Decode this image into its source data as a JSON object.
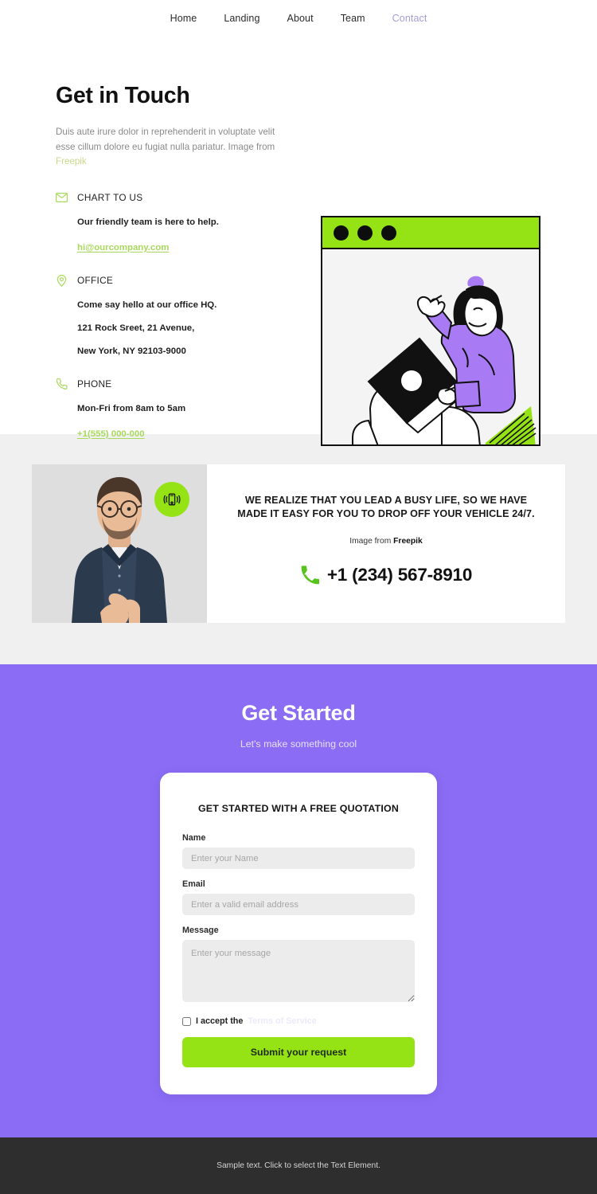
{
  "nav": {
    "items": [
      {
        "label": "Home",
        "active": false
      },
      {
        "label": "Landing",
        "active": false
      },
      {
        "label": "About",
        "active": false
      },
      {
        "label": "Team",
        "active": false
      },
      {
        "label": "Contact",
        "active": true
      }
    ]
  },
  "hero": {
    "title": "Get in Touch",
    "description": "Duis aute irure dolor in reprehenderit in voluptate velit esse cillum dolore eu fugiat nulla pariatur. Image from",
    "credit": "Freepik",
    "contacts": [
      {
        "icon": "envelope-icon",
        "title": "CHART TO US",
        "line1": "Our friendly team is here to help.",
        "link": "hi@ourcompany.com"
      },
      {
        "icon": "map-pin-icon",
        "title": "OFFICE",
        "line1": "Come say hello at our office HQ.",
        "line2": "121 Rock Sreet, 21 Avenue,",
        "line3": "New York, NY 92103-9000"
      },
      {
        "icon": "phone-icon",
        "title": "PHONE",
        "line1": "Mon-Fri from 8am to 5am",
        "link": "+1(555) 000-000"
      }
    ],
    "illustration": {
      "name": "browser-window-illustration",
      "dots": 3,
      "bar_color": "#95e215"
    }
  },
  "banner": {
    "photo_alt": "man-with-glasses-photo",
    "badge_icon": "vibrating-phone-icon",
    "headline": "WE REALIZE THAT YOU LEAD A BUSY LIFE, SO WE HAVE MADE IT EASY FOR YOU TO DROP OFF YOUR VEHICLE 24/7.",
    "credit_prefix": "Image from ",
    "credit_source": "Freepik",
    "phone": "+1 (234) 567-8910"
  },
  "cta": {
    "title": "Get Started",
    "subtitle": "Let's make something cool",
    "form": {
      "title": "GET STARTED WITH A FREE QUOTATION",
      "name_label": "Name",
      "name_placeholder": "Enter your Name",
      "name_value": "",
      "email_label": "Email",
      "email_placeholder": "Enter a valid email address",
      "email_value": "",
      "message_label": "Message",
      "message_placeholder": "Enter your message",
      "message_value": "",
      "accept_text": "I accept the",
      "tos_label": "Terms of Service",
      "submit_label": "Submit your request"
    }
  },
  "footer": {
    "text": "Sample text. Click to select the Text Element."
  },
  "colors": {
    "accent_green": "#95e215",
    "accent_purple": "#8b6df5",
    "link_green": "#a8d95c",
    "footer_dark": "#2e2e2e",
    "section_gray": "#f0f0f0"
  }
}
